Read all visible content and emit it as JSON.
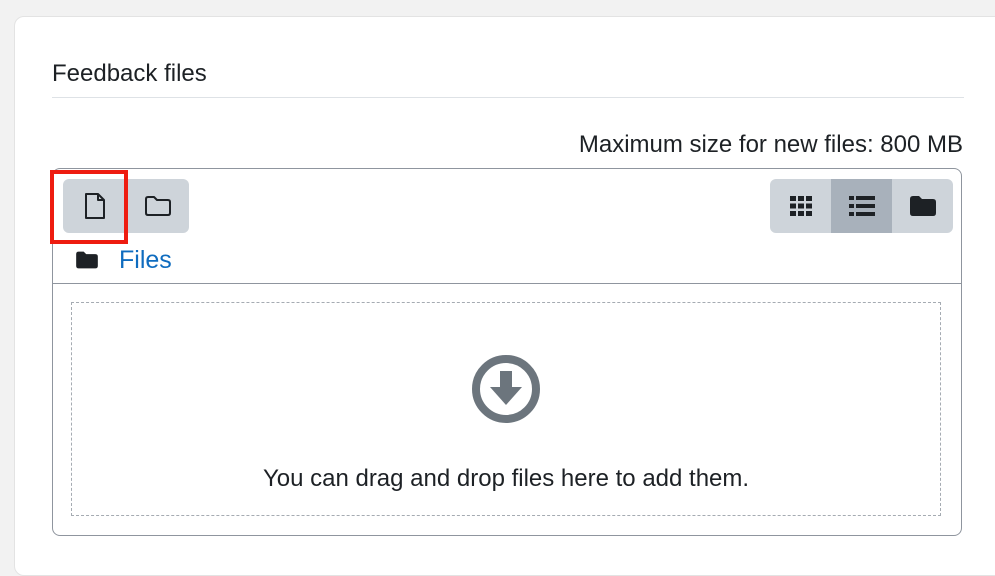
{
  "section": {
    "title": "Feedback files"
  },
  "filemanager": {
    "max_size_text": "Maximum size for new files: 800 MB",
    "toolbar": {
      "add_file_icon": "file-icon",
      "create_folder_icon": "folder-outline-icon",
      "views": [
        {
          "name": "icons-view",
          "icon": "grid-icon",
          "active": false
        },
        {
          "name": "list-view",
          "icon": "list-icon",
          "active": true
        },
        {
          "name": "tree-view",
          "icon": "folder-solid-icon",
          "active": false
        }
      ]
    },
    "path": {
      "folder_icon": "folder-solid-icon",
      "label": "Files"
    },
    "dropzone": {
      "icon": "arrow-circle-down-icon",
      "text": "You can drag and drop files here to add them."
    }
  },
  "colors": {
    "link": "#0f6cbf",
    "button_bg": "#ced4da",
    "button_active_bg": "#a8b1bb",
    "highlight": "#ee1c10",
    "icon_gray": "#6c757d"
  }
}
